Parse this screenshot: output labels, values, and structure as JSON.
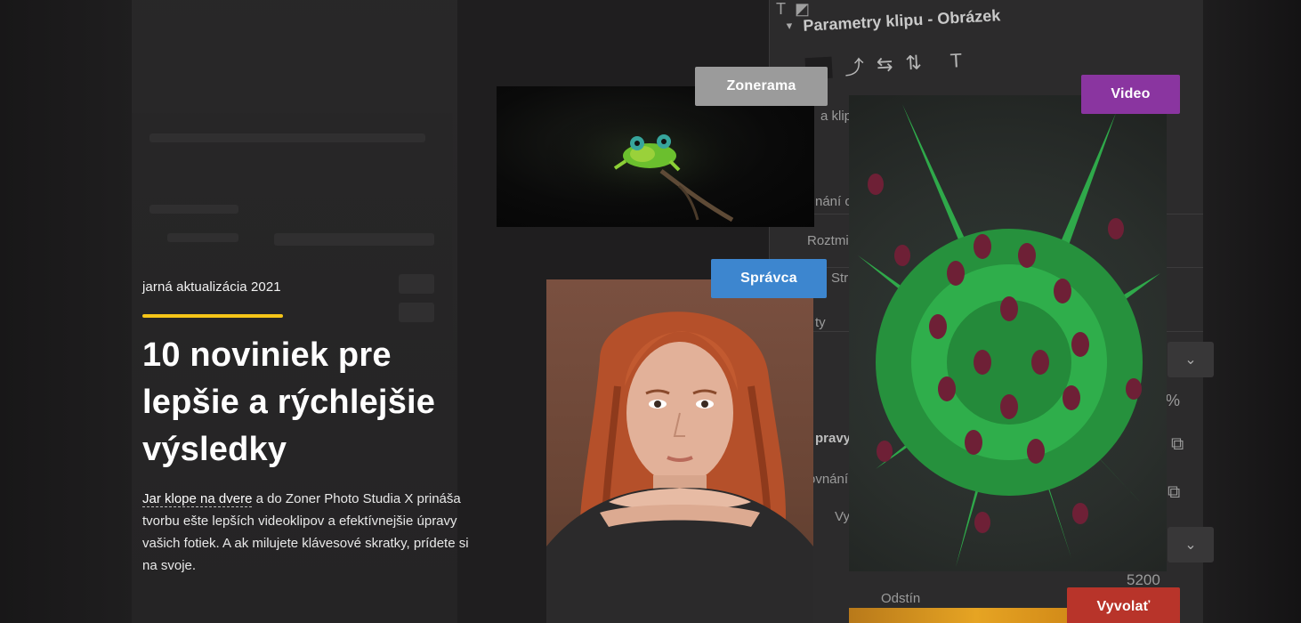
{
  "hero": {
    "kicker": "jarná aktualizácia 2021",
    "headline_lines": [
      "10 noviniek pre",
      "lepšie a rýchlejšie",
      "výsledky"
    ],
    "desc_link": "Jar klope na dvere",
    "desc_rest": " a do Zoner Photo Studia X prináša tvorbu ešte lepších videoklipov a efektívnejšie úpravy vašich fotiek. A ak milujete klávesové skratky, prídete si na svoje."
  },
  "tags": {
    "zonerama": "Zonerama",
    "spravca": "Správca",
    "video": "Video",
    "vyvolat": "Vyvolať"
  },
  "colors": {
    "accent_yellow": "#f5c518",
    "zonerama": "#9b9b9b",
    "spravca": "#3d86cf",
    "video": "#8a35a0",
    "vyvolat": "#b8342a"
  },
  "background_panel": {
    "title": "Parametry klipu - Obrázek",
    "labels": [
      "a klipu",
      "nání o",
      "Roztmi",
      "Str",
      "ty",
      "pravy",
      "ovnání",
      "Vy",
      "Odstín"
    ],
    "percent": "%",
    "value": "5200"
  }
}
